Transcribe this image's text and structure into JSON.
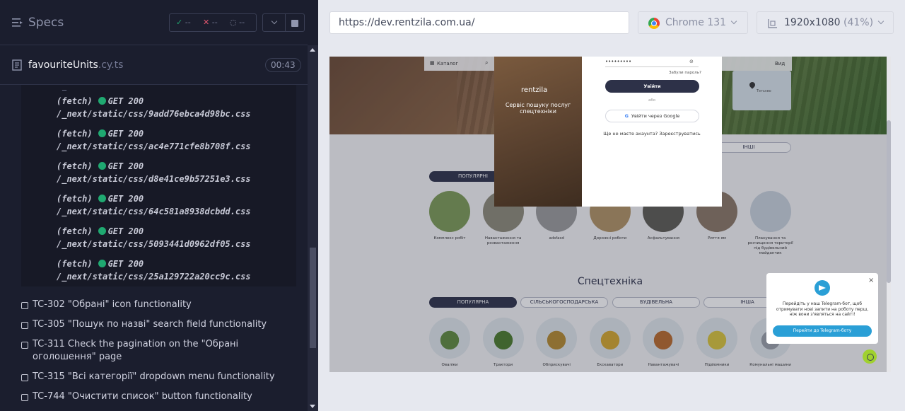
{
  "specs": {
    "title": "Specs",
    "passed": "--",
    "failed": "--",
    "pending": "--"
  },
  "file": {
    "name": "favouriteUnits",
    "ext": ".cy.ts",
    "duration": "00:43"
  },
  "logs": [
    {
      "prefix": "(fetch)",
      "method": "GET 200",
      "url": "/_next/static/css/9add76ebca4d98bc.css"
    },
    {
      "prefix": "(fetch)",
      "method": "GET 200",
      "url": "/_next/static/css/ac4e771cfe8b708f.css"
    },
    {
      "prefix": "(fetch)",
      "method": "GET 200",
      "url": "/_next/static/css/d8e41ce9b57251e3.css"
    },
    {
      "prefix": "(fetch)",
      "method": "GET 200",
      "url": "/_next/static/css/64c581a8938dcbdd.css"
    },
    {
      "prefix": "(fetch)",
      "method": "GET 200",
      "url": "/_next/static/css/5093441d0962df05.css"
    },
    {
      "prefix": "(fetch)",
      "method": "GET 200",
      "url": "/_next/static/css/25a129722a20cc9c.css"
    }
  ],
  "tests": [
    "TC-302 \"Обрані\" icon functionality",
    "TC-305 \"Пошук по назві\" search field functionality",
    "TC-311 Check the pagination on the \"Обрані оголошення\" page",
    "TC-315 \"Всі категорії\" dropdown menu functionality",
    "TC-744 \"Очистити список\" button functionality"
  ],
  "browser": {
    "url": "https://dev.rentzila.com.ua/",
    "name": "Chrome 131",
    "viewport": "1920x1080",
    "zoom": "(41%)"
  },
  "app": {
    "catalog": "Каталог",
    "view": "Вид",
    "map_town": "Тетьєво",
    "modal_logo": "rentzila",
    "modal_tagline": "Сервіс пошуку послуг спецтехніки",
    "password_value": "•••••••••",
    "forgot": "Забули пароль?",
    "login": "Увійти",
    "or": "або",
    "google": "Увійти через Google",
    "signup": "Ще не маєте акаунта? Зареєструватись",
    "services_tabs": [
      "ПОПУЛЯРНІ",
      "ІНШІ"
    ],
    "services": [
      "Комплекс робіт",
      "Навантаження та розвантаження",
      "adsfasd",
      "Дорожні роботи",
      "Асфальтування",
      "Риття ям",
      "Планування та розчищення території під будівельний майданчик"
    ],
    "spec_title": "Спецтехніка",
    "spec_tabs": [
      "ПОПУЛЯРНА",
      "СІЛЬСЬКОГОСПОДАРСЬКА",
      "БУДІВЕЛЬНА",
      "ІНША"
    ],
    "spec_items": [
      "Оваліки",
      "Трактори",
      "Обприскувачі",
      "Екскаватори",
      "Навантажувачі",
      "Підйомники",
      "Комунальні машини"
    ],
    "tg_text": "Перейдіть у наш Telegram-бот, щоб отримувати нові запити на роботу перш, ніж вони з'являться на сайті!",
    "tg_button": "Перейти до Telegram-боту",
    "tg_close": "×"
  }
}
